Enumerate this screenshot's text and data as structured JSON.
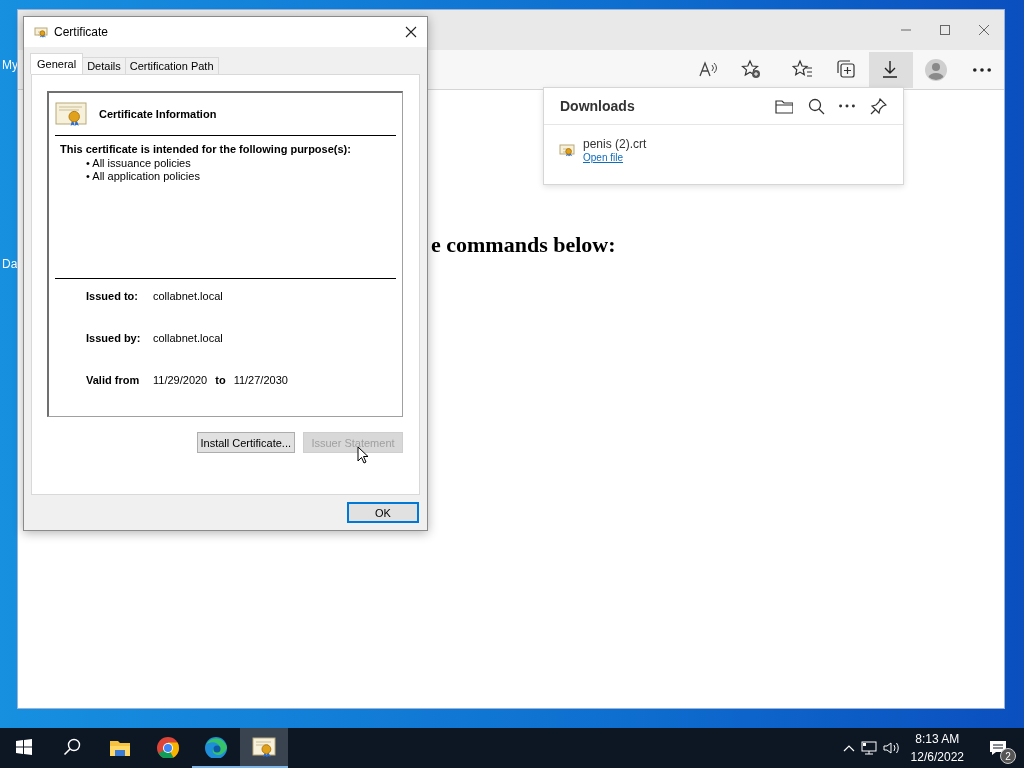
{
  "desktop": {
    "icons": [
      {
        "label": "My"
      },
      {
        "label": "Da"
      }
    ]
  },
  "browser": {
    "heading_fragment": "e commands below:",
    "toolbar": [
      {
        "kind": "read-aloud",
        "selected": false
      },
      {
        "kind": "add-favorite",
        "selected": false
      },
      {
        "kind": "favorites",
        "selected": false
      },
      {
        "kind": "collections",
        "selected": false
      },
      {
        "kind": "downloads",
        "selected": true
      },
      {
        "kind": "profile",
        "selected": false
      },
      {
        "kind": "more",
        "selected": false
      }
    ],
    "downloads": {
      "title": "Downloads",
      "items": [
        {
          "name": "penis (2).crt",
          "action": "Open file"
        }
      ]
    }
  },
  "certificate_dialog": {
    "title": "Certificate",
    "tabs": [
      {
        "label": "General",
        "selected": true
      },
      {
        "label": "Details",
        "selected": false
      },
      {
        "label": "Certification Path",
        "selected": false
      }
    ],
    "header": "Certificate Information",
    "purpose_heading": "This certificate is intended for the following purpose(s):",
    "purposes": [
      "• All issuance policies",
      "• All application policies"
    ],
    "fields": [
      {
        "label": "Issued to:",
        "value": "collabnet.local"
      },
      {
        "label": "Issued by:",
        "value": "collabnet.local"
      }
    ],
    "validity": {
      "label": "Valid from",
      "from": "11/29/2020",
      "to_label": "to",
      "to": "11/27/2030"
    },
    "buttons": [
      {
        "label": "Install Certificate...",
        "disabled": false
      },
      {
        "label": "Issuer Statement",
        "disabled": true
      }
    ],
    "ok": "OK"
  },
  "taskbar": {
    "apps": [
      {
        "kind": "explorer",
        "selected": false,
        "running": false
      },
      {
        "kind": "chrome",
        "selected": false,
        "running": false
      },
      {
        "kind": "edge",
        "selected": false,
        "running": true
      },
      {
        "kind": "certificate",
        "selected": true,
        "running": true
      }
    ],
    "time": "8:13 AM",
    "date": "12/6/2022",
    "notifications": "2"
  }
}
